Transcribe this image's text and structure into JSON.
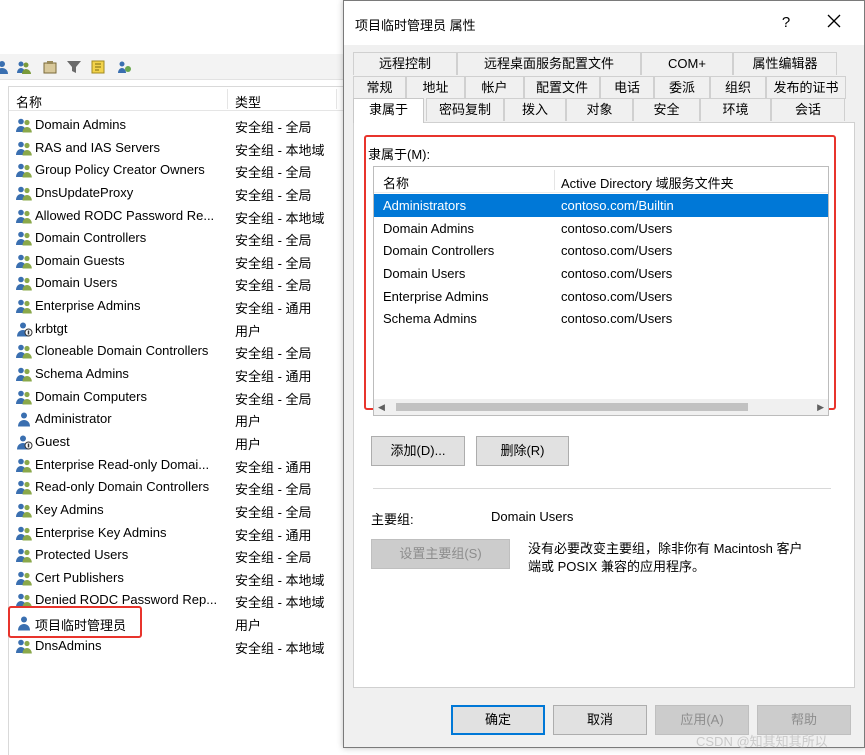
{
  "console": {
    "list_header": {
      "name": "名称",
      "type": "类型"
    },
    "rows": [
      {
        "name": "Domain Admins",
        "type": "安全组 - 全局",
        "icon": "group-icon"
      },
      {
        "name": "RAS and IAS Servers",
        "type": "安全组 - 本地域",
        "icon": "group-icon"
      },
      {
        "name": "Group Policy Creator Owners",
        "type": "安全组 - 全局",
        "icon": "group-icon"
      },
      {
        "name": "DnsUpdateProxy",
        "type": "安全组 - 全局",
        "icon": "group-icon"
      },
      {
        "name": "Allowed RODC Password Re...",
        "type": "安全组 - 本地域",
        "icon": "group-icon"
      },
      {
        "name": "Domain Controllers",
        "type": "安全组 - 全局",
        "icon": "group-icon"
      },
      {
        "name": "Domain Guests",
        "type": "安全组 - 全局",
        "icon": "group-icon"
      },
      {
        "name": "Domain Users",
        "type": "安全组 - 全局",
        "icon": "group-icon"
      },
      {
        "name": "Enterprise Admins",
        "type": "安全组 - 通用",
        "icon": "group-icon"
      },
      {
        "name": "krbtgt",
        "type": "用户",
        "icon": "disabled-user-icon"
      },
      {
        "name": "Cloneable Domain Controllers",
        "type": "安全组 - 全局",
        "icon": "group-icon"
      },
      {
        "name": "Schema Admins",
        "type": "安全组 - 通用",
        "icon": "group-icon"
      },
      {
        "name": "Domain Computers",
        "type": "安全组 - 全局",
        "icon": "group-icon"
      },
      {
        "name": "Administrator",
        "type": "用户",
        "icon": "user-icon"
      },
      {
        "name": "Guest",
        "type": "用户",
        "icon": "disabled-user-icon"
      },
      {
        "name": "Enterprise Read-only Domai...",
        "type": "安全组 - 通用",
        "icon": "group-icon"
      },
      {
        "name": "Read-only Domain Controllers",
        "type": "安全组 - 全局",
        "icon": "group-icon"
      },
      {
        "name": "Key Admins",
        "type": "安全组 - 全局",
        "icon": "group-icon"
      },
      {
        "name": "Enterprise Key Admins",
        "type": "安全组 - 通用",
        "icon": "group-icon"
      },
      {
        "name": "Protected Users",
        "type": "安全组 - 全局",
        "icon": "group-icon"
      },
      {
        "name": "Cert Publishers",
        "type": "安全组 - 本地域",
        "icon": "group-icon"
      },
      {
        "name": "Denied RODC Password Rep...",
        "type": "安全组 - 本地域",
        "icon": "group-icon"
      },
      {
        "name": "项目临时管理员",
        "type": "用户",
        "icon": "user-icon"
      },
      {
        "name": "DnsAdmins",
        "type": "安全组 - 本地域",
        "icon": "group-icon"
      }
    ]
  },
  "dialog": {
    "title": "项目临时管理员 属性",
    "help": "?",
    "tabs_row1": [
      "远程控制",
      "远程桌面服务配置文件",
      "COM+",
      "属性编辑器"
    ],
    "tabs_row2": [
      "常规",
      "地址",
      "帐户",
      "配置文件",
      "电话",
      "委派",
      "组织",
      "发布的证书"
    ],
    "tabs_row3": [
      "隶属于",
      "密码复制",
      "拨入",
      "对象",
      "安全",
      "环境",
      "会话"
    ],
    "member_of_label": "隶属于(M):",
    "member_list": {
      "columns": [
        "名称",
        "Active Directory 域服务文件夹"
      ],
      "rows": [
        {
          "name": "Administrators",
          "folder": "contoso.com/Builtin",
          "selected": true
        },
        {
          "name": "Domain Admins",
          "folder": "contoso.com/Users"
        },
        {
          "name": "Domain Controllers",
          "folder": "contoso.com/Users"
        },
        {
          "name": "Domain Users",
          "folder": "contoso.com/Users"
        },
        {
          "name": "Enterprise Admins",
          "folder": "contoso.com/Users"
        },
        {
          "name": "Schema Admins",
          "folder": "contoso.com/Users"
        }
      ]
    },
    "add_button": "添加(D)...",
    "remove_button": "删除(R)",
    "primary_group_label": "主要组:",
    "primary_group_value": "Domain Users",
    "set_primary_button": "设置主要组(S)",
    "note_line1": "没有必要改变主要组，除非你有 Macintosh 客户",
    "note_line2": "端或 POSIX 兼容的应用程序。",
    "ok_button": "确定",
    "cancel_button": "取消",
    "apply_button": "应用(A)",
    "help_button": "帮助"
  },
  "watermark": "CSDN @知其知其所以",
  "colors": {
    "selection": "#0078d7",
    "highlight_box": "#e8342c"
  }
}
